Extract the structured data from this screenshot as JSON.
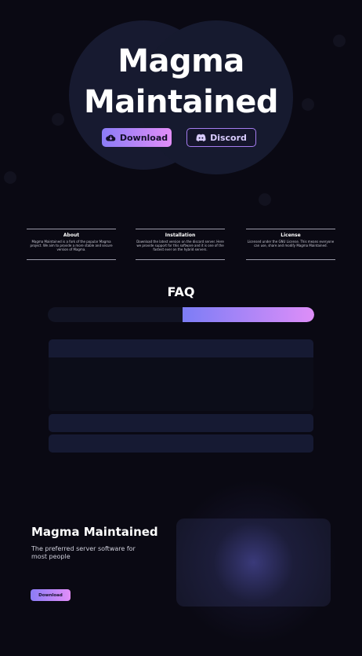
{
  "hero": {
    "title_line1": "Magma",
    "title_line2": "Maintained",
    "download_label": "Download",
    "discord_label": "Discord"
  },
  "info": [
    {
      "title": "About",
      "text": "Magma Maintained is a fork of the popular Magma project. We aim to provide a more stable and secure version of Magma."
    },
    {
      "title": "Installation",
      "text": "Download the latest version on the discord server. Here we provide support for this software and it is one of the fastest ever on the hybrid servers."
    },
    {
      "title": "License",
      "text": "Licensed under the GNU License. This means everyone can use, share and modify Magma Maintained."
    }
  ],
  "faq": {
    "title": "FAQ",
    "active_tab": 1
  },
  "footer": {
    "title": "Magma Maintained",
    "subtitle": "The preferred server software for most people",
    "download_label": "Download"
  },
  "colors": {
    "background": "#0a0913",
    "accent_start": "#7c7df6",
    "accent_end": "#e28ef8"
  }
}
